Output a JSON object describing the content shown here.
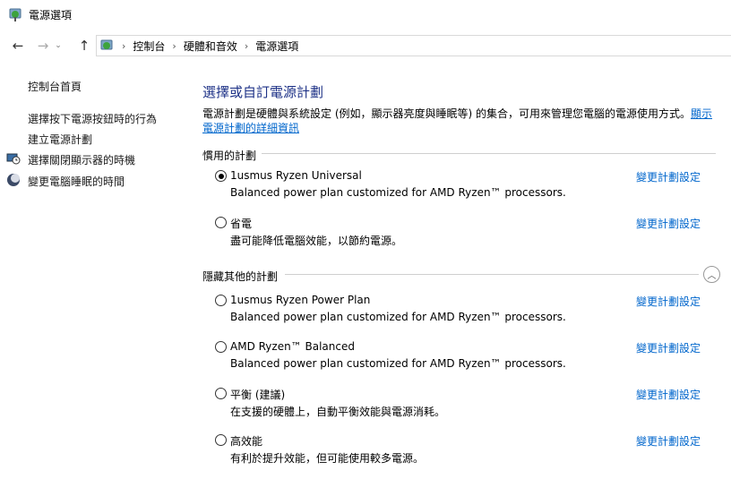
{
  "window": {
    "title": "電源選項"
  },
  "nav": {
    "back_icon": "arrow-left-icon",
    "forward_icon": "arrow-right-icon",
    "up_icon": "arrow-up-icon",
    "breadcrumbs": [
      "控制台",
      "硬體和音效",
      "電源選項"
    ]
  },
  "sidebar": {
    "home": "控制台首頁",
    "items": [
      {
        "label": "選擇按下電源按鈕時的行為",
        "icon": ""
      },
      {
        "label": "建立電源計劃",
        "icon": ""
      },
      {
        "label": "選擇關閉顯示器的時機",
        "icon": "monitor-clock-icon"
      },
      {
        "label": "變更電腦睡眠的時間",
        "icon": "moon-icon"
      }
    ]
  },
  "main": {
    "title": "選擇或自訂電源計劃",
    "description": "電源計劃是硬體與系統設定 (例如，顯示器亮度與睡眠等) 的集合，可用來管理您電腦的電源使用方式。",
    "more_link": "顯示電源計劃的詳細資訊",
    "preferred_header": "慣用的計劃",
    "hidden_header": "隱藏其他的計劃",
    "change_link": "變更計劃設定",
    "preferred_plans": [
      {
        "name": "1usmus Ryzen Universal",
        "desc": "Balanced power plan customized for AMD Ryzen™ processors.",
        "selected": true
      },
      {
        "name": "省電",
        "desc": "盡可能降低電腦效能，以節約電源。",
        "selected": false
      }
    ],
    "hidden_plans": [
      {
        "name": "1usmus Ryzen Power Plan",
        "desc": "Balanced power plan customized for AMD Ryzen™ processors.",
        "selected": false
      },
      {
        "name": "AMD Ryzen™ Balanced",
        "desc": "Balanced power plan customized for AMD Ryzen™ processors.",
        "selected": false
      },
      {
        "name": "平衡 (建議)",
        "desc": "在支援的硬體上，自動平衡效能與電源消耗。",
        "selected": false
      },
      {
        "name": "高效能",
        "desc": "有利於提升效能，但可能使用較多電源。",
        "selected": false
      }
    ]
  },
  "colors": {
    "link": "#0066cc",
    "title": "#1e3287"
  }
}
